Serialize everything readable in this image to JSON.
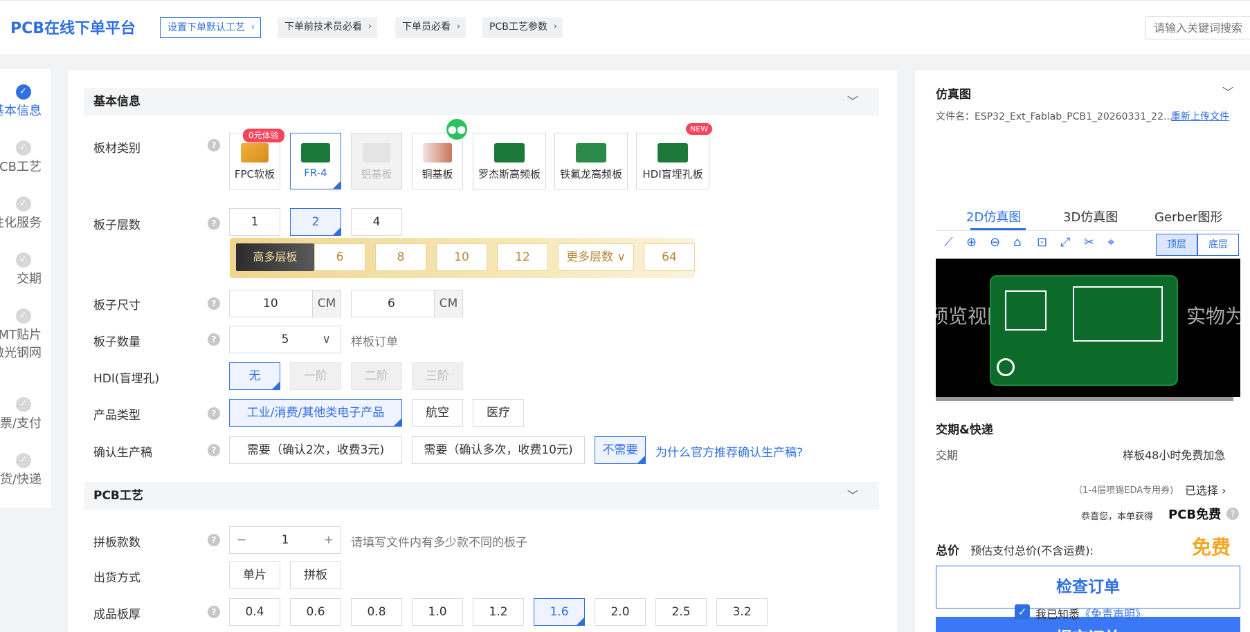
{
  "header": {
    "brand": "PCB在线下单平台",
    "links": [
      "设置下单默认工艺",
      "下单前技术员必看",
      "下单员必看",
      "PCB工艺参数"
    ],
    "search_placeholder": "请输入关键词搜索"
  },
  "steps": [
    "基本信息",
    "PCB工艺",
    "个性化服务",
    "交期",
    "SMT贴片",
    "激光钢网",
    "发票/支付",
    "发货/快递"
  ],
  "steps_visible_text": [
    "基本信息",
    "PCB工艺",
    "性化服务",
    "交期",
    "MT贴片",
    "激光钢网",
    "票/支付",
    "货/快递"
  ],
  "sections": {
    "basic": "基本信息",
    "pcb": "PCB工艺"
  },
  "help_icon": "?",
  "form": {
    "material": {
      "label": "板材类别",
      "options": [
        "FPC软板",
        "FR-4",
        "铝基板",
        "铜基板",
        "罗杰斯高频板",
        "铁氟龙高频板",
        "HDI盲埋孔板"
      ],
      "badge_fpc": "0元体验",
      "badge_hdi": "NEW",
      "selected": "FR-4"
    },
    "layers": {
      "label": "板子层数",
      "options": [
        "1",
        "2",
        "4"
      ],
      "selected": "2",
      "premium_tag": "高多层板",
      "premium_options": [
        "6",
        "8",
        "10",
        "12"
      ],
      "more_label": "更多层数",
      "max_option": "64"
    },
    "size": {
      "label": "板子尺寸",
      "width": "10",
      "height": "6",
      "unit": "CM"
    },
    "quantity": {
      "label": "板子数量",
      "value": "5",
      "hint": "样板订单"
    },
    "hdi": {
      "label": "HDI(盲埋孔)",
      "options": [
        "无",
        "一阶",
        "二阶",
        "三阶"
      ],
      "selected": "无"
    },
    "product_type": {
      "label": "产品类型",
      "options": [
        "工业/消费/其他类电子产品",
        "航空",
        "医疗"
      ],
      "selected": "工业/消费/其他类电子产品"
    },
    "confirm": {
      "label": "确认生产稿",
      "options": [
        "需要（确认2次，收费3元)",
        "需要（确认多次，收费10元)",
        "不需要"
      ],
      "selected": "不需要",
      "link": "为什么官方推荐确认生产稿?"
    },
    "panel_count": {
      "label": "拼板款数",
      "value": "1",
      "minus": "−",
      "plus": "+",
      "hint": "请填写文件内有多少款不同的板子"
    },
    "shipping_mode": {
      "label": "出货方式",
      "options": [
        "单片",
        "拼板"
      ]
    },
    "thickness": {
      "label": "成品板厚",
      "options": [
        "0.4",
        "0.6",
        "0.8",
        "1.0",
        "1.2",
        "1.6",
        "2.0",
        "2.5",
        "3.2"
      ],
      "selected": "1.6"
    }
  },
  "sidebar": {
    "sim_title": "仿真图",
    "file_label": "文件名：",
    "file_name": "ESP32_Ext_Fablab_PCB1_20260331_22...",
    "reupload": "重新上传文件",
    "tabs": [
      "2D仿真图",
      "3D仿真图",
      "Gerber图形"
    ],
    "active_tab": "2D仿真图",
    "layer_buttons": [
      "顶层",
      "底层"
    ],
    "watermark_left": "预览视图",
    "watermark_right": "实物为准",
    "delivery_title": "交期&快递",
    "delivery_label": "交期",
    "delivery_value": "样板48小时免费加急",
    "eda_note": "（1-4层喷锡EDA专用券)",
    "eda_selected": "已选择",
    "congrats_text": "恭喜您，本单获得",
    "congrats_bold": "PCB免费",
    "total_label": "总价",
    "total_sub": "预估支付总价(不含运费):",
    "total_value": "免费",
    "check_btn": "检查订单",
    "submit_btn": "提交订单",
    "agree_text": "我已知悉",
    "agree_link": "《免责声明》"
  },
  "colors": {
    "accent": "#2f6fe0",
    "submit": "#3b78f5",
    "price": "#f5a623",
    "badge": "#f5455c",
    "wechat": "#2bc15e"
  }
}
